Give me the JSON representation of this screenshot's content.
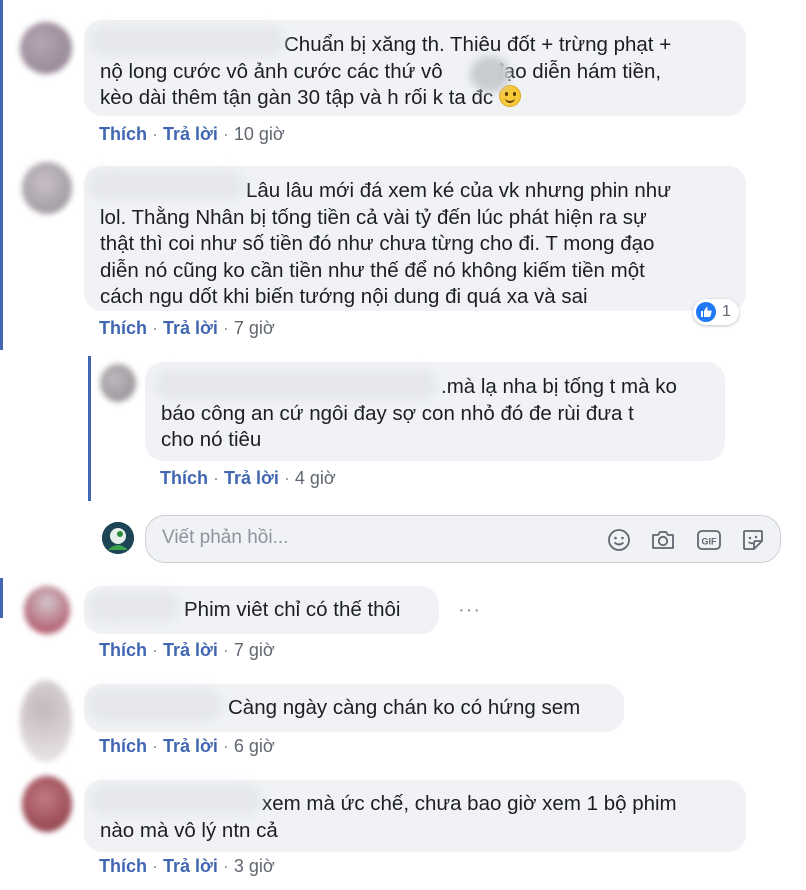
{
  "comments": [
    {
      "lines": [
        "Chuẩn bị xăng th. Thiêu đốt + trừng phạt +",
        "nộ long cước vô ảnh cước các thứ vô ",
        "kèo dài thêm tận gàn 30 tập và h rối k ta đc"
      ],
      "line2_tail": "đạo diễn hám tiền,",
      "like_label": "Thích",
      "reply_label": "Trả lời",
      "sep": "·",
      "time": "10 giờ"
    },
    {
      "lines": [
        "Lâu lâu mới đá xem ké của vk nhưng phin như",
        "lol. Thằng Nhân bị tống tiền cả vài tỷ đến lúc phát hiện ra sự",
        "thật thì coi như số tiền đó như chưa từng cho đi. T mong đạo",
        "diễn nó cũng ko cần tiền như thế để nó không kiếm tiền một",
        "cách ngu dốt khi biến tướng nội dung đi quá xa và sai"
      ],
      "like_label": "Thích",
      "reply_label": "Trả lời",
      "sep": "·",
      "time": "7 giờ",
      "reaction_count": "1"
    },
    {
      "lines": [
        ".mà lạ nha bị tống t mà ko",
        "báo công an cứ ngôi đay sợ con nhỏ đó đe rùi đưa t",
        "cho nó tiêu"
      ],
      "like_label": "Thích",
      "reply_label": "Trả lời",
      "sep": "·",
      "time": "4 giờ"
    },
    {
      "lines": [
        "Phim viêt chỉ có thế thôi"
      ],
      "like_label": "Thích",
      "reply_label": "Trả lời",
      "sep": "·",
      "time": "7 giờ"
    },
    {
      "lines": [
        "Càng ngày càng chán ko có hứng sem"
      ],
      "like_label": "Thích",
      "reply_label": "Trả lời",
      "sep": "·",
      "time": "6 giờ"
    },
    {
      "lines": [
        "xem mà ức chế, chưa bao giờ xem 1 bộ phim",
        "nào mà vô lý ntn cả"
      ],
      "like_label": "Thích",
      "reply_label": "Trả lời",
      "sep": "·",
      "time": "3 giờ"
    }
  ],
  "reply_box": {
    "placeholder": "Viết phản hồi...",
    "icons": [
      "emoji-icon",
      "camera-icon",
      "gif-icon",
      "sticker-icon"
    ],
    "gif_text": "GIF"
  },
  "more_options": "···",
  "colors": {
    "link": "#4267b2",
    "bubble": "#f0f2f5",
    "thread_line": "#4267b2",
    "like": "#2078f4"
  }
}
